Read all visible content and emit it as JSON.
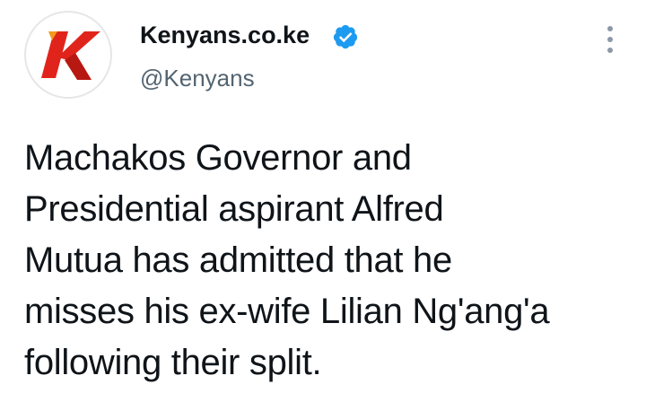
{
  "account": {
    "display_name": "Kenyans.co.ke",
    "handle": "@Kenyans",
    "verified": true,
    "avatar_icon": "kenyans-k-logo",
    "avatar_letter": "K",
    "brand_color": "#e0241b",
    "verified_color": "#1d9bf0"
  },
  "menu": {
    "icon": "more-options-vertical-icon"
  },
  "tweet": {
    "text": "Machakos Governor and\nPresidential aspirant Alfred\nMutua has admitted that he\nmisses his ex-wife Lilian Ng'ang'a\nfollowing their split."
  }
}
